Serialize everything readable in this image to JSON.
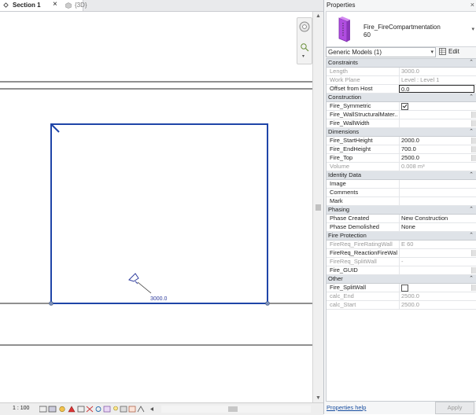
{
  "tabs": {
    "section_label": "Section 1",
    "threed_label": "{3D}"
  },
  "view": {
    "dimension_text": "3000.0",
    "scale": "1 : 100",
    "colors": {
      "element_blue": "#1f45a8",
      "level_line": "#222222",
      "highlight": "#2f3d9e"
    }
  },
  "props": {
    "title": "Properties",
    "family": "Fire_FireCompartmentation",
    "type": "60",
    "selector": "Generic Models (1)",
    "edit_type": "Edit Type",
    "help": "Properties help",
    "apply": "Apply",
    "sections": {
      "constraints": "Constraints",
      "construction": "Construction",
      "dimensions": "Dimensions",
      "identity": "Identity Data",
      "phasing": "Phasing",
      "fire_protection": "Fire Protection",
      "other": "Other"
    },
    "rows": {
      "length": {
        "name": "Length",
        "value": "3000.0"
      },
      "work_plane": {
        "name": "Work Plane",
        "value": "Level : Level 1"
      },
      "offset": {
        "name": "Offset from Host",
        "value": "0.0"
      },
      "fire_symmetric": {
        "name": "Fire_Symmetric",
        "checked": true
      },
      "fire_wall_structural": {
        "name": "Fire_WallStructuralMater..."
      },
      "fire_wall_width": {
        "name": "Fire_WallWidth"
      },
      "fire_start_height": {
        "name": "Fire_StartHeight",
        "value": "2000.0"
      },
      "fire_end_height": {
        "name": "Fire_EndHeight",
        "value": "700.0"
      },
      "fire_top": {
        "name": "Fire_Top",
        "value": "2500.0"
      },
      "volume": {
        "name": "Volume",
        "value": "0.008 m³"
      },
      "image": {
        "name": "Image"
      },
      "comments": {
        "name": "Comments"
      },
      "mark": {
        "name": "Mark"
      },
      "phase_created": {
        "name": "Phase Created",
        "value": "New Construction"
      },
      "phase_demolished": {
        "name": "Phase Demolished",
        "value": "None"
      },
      "firereq_rating": {
        "name": "FireReq_FireRatingWall",
        "value": "E 60"
      },
      "firereq_reaction": {
        "name": "FireReq_ReactionFireWall"
      },
      "firereq_split": {
        "name": "FireReq_SplitWall",
        "value": "-"
      },
      "fire_guid": {
        "name": "Fire_GUID"
      },
      "fire_splitwall": {
        "name": "Fire_SplitWall",
        "checked": false
      },
      "calc_end": {
        "name": "calc_End",
        "value": "2500.0"
      },
      "calc_start": {
        "name": "calc_Start",
        "value": "2500.0"
      }
    }
  }
}
